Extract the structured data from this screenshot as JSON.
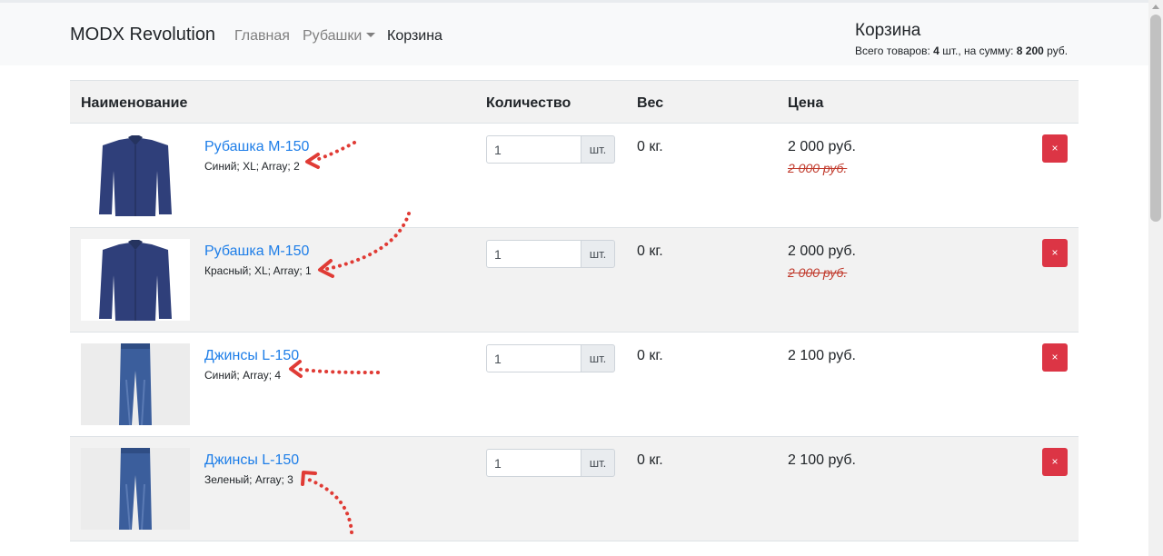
{
  "navbar": {
    "brand": "MODX Revolution",
    "links": [
      {
        "label": "Главная"
      },
      {
        "label": "Рубашки"
      },
      {
        "label": "Корзина"
      }
    ]
  },
  "minicart": {
    "title": "Корзина",
    "total_label": "Всего товаров:",
    "count": "4",
    "count_unit": "шт., на сумму:",
    "sum": "8 200",
    "currency": "руб."
  },
  "table": {
    "headers": {
      "name": "Наименование",
      "qty": "Количество",
      "weight": "Вес",
      "price": "Цена"
    },
    "rows": [
      {
        "name": "Рубашка M-150",
        "options": "Синий; XL; Array; 2",
        "qty": "1",
        "unit": "шт.",
        "weight": "0 кг.",
        "price": "2 000 руб.",
        "old_price": "2 000 руб.",
        "delete": "×",
        "image": "shirt"
      },
      {
        "name": "Рубашка M-150",
        "options": "Красный; XL; Array; 1",
        "qty": "1",
        "unit": "шт.",
        "weight": "0 кг.",
        "price": "2 000 руб.",
        "old_price": "2 000 руб.",
        "delete": "×",
        "image": "shirt"
      },
      {
        "name": "Джинсы L-150",
        "options": "Синий; Array; 4",
        "qty": "1",
        "unit": "шт.",
        "weight": "0 кг.",
        "price": "2 100 руб.",
        "delete": "×",
        "image": "jeans"
      },
      {
        "name": "Джинсы L-150",
        "options": "Зеленый; Array; 3",
        "qty": "1",
        "unit": "шт.",
        "weight": "0 кг.",
        "price": "2 100 руб.",
        "delete": "×",
        "image": "jeans"
      }
    ]
  },
  "colors": {
    "link": "#1e7ee8",
    "danger": "#dc3545",
    "old_price": "#c0392b",
    "annotation": "#e03b35"
  }
}
